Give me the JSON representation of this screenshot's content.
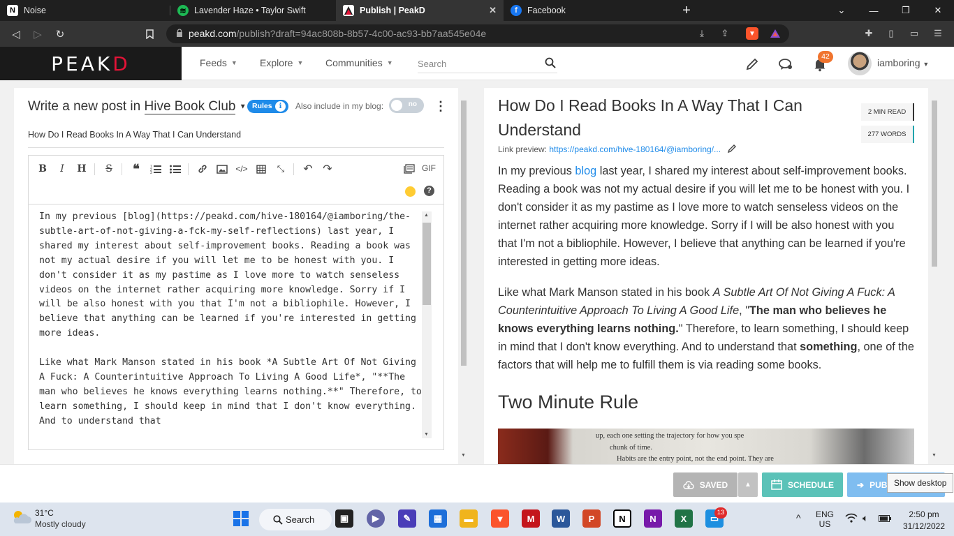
{
  "browser": {
    "tabs": [
      {
        "title": "Noise",
        "icon": "notion-icon"
      },
      {
        "title": "Lavender Haze • Taylor Swift",
        "icon": "spotify-icon"
      },
      {
        "title": "Publish | PeakD",
        "icon": "peakd-icon",
        "active": true
      },
      {
        "title": "Facebook",
        "icon": "facebook-icon"
      }
    ],
    "new_tab": "+",
    "url_host": "peakd.com",
    "url_path": "/publish?draft=94ac808b-8b57-4c00-ac93-bb7aa545e04e"
  },
  "header": {
    "logo_main": "PEAK",
    "logo_accent": "D",
    "nav": [
      "Feeds",
      "Explore",
      "Communities"
    ],
    "search_placeholder": "Search",
    "notifications_count": "42",
    "username": "iamboring"
  },
  "editor": {
    "write_prefix": "Write a new post in",
    "community": "Hive Book Club",
    "rules_label": "Rules",
    "also_include_label": "Also include in my blog:",
    "toggle_label": "no",
    "post_title": "How Do I Read Books In A Way That I Can Understand",
    "toolbar": [
      "bold",
      "italic",
      "heading",
      "strikethrough",
      "quote",
      "ordered-list",
      "unordered-list",
      "link",
      "image",
      "code",
      "table",
      "fullscreen",
      "undo",
      "redo"
    ],
    "gif_label": "GIF",
    "markdown": "In my previous [blog](https://peakd.com/hive-180164/@iamboring/the-subtle-art-of-not-giving-a-fck-my-self-reflections) last year, I shared my interest about self-improvement books. Reading a book was not my actual desire if you will let me to be honest with you. I don't consider it as my pastime as I love more to watch senseless videos on the internet rather acquiring more knowledge. Sorry if I will be also honest with you that I'm not a bibliophile. However, I believe that anything can be learned if you're interested in getting more ideas.\n\nLike what Mark Manson stated in his book *A Subtle Art Of Not Giving A Fuck: A Counterintuitive Approach To Living A Good Life*, \"**The man who believes he knows everything learns nothing.**\" Therefore, to learn something, I should keep in mind that I don't know everything. And to understand that"
  },
  "preview": {
    "title": "How Do I Read Books In A Way That I Can Understand",
    "read_time": "2 MIN READ",
    "word_count": "277 WORDS",
    "link_preview_label": "Link preview:",
    "link_preview_url": "https://peakd.com/hive-180164/@iamboring/...",
    "p1_before": "In my previous ",
    "p1_link": "blog",
    "p1_after": " last year, I shared my interest about self-improvement books. Reading a book was not my actual desire if you will let me to be honest with you. I don't consider it as my pastime as I love more to watch senseless videos on the internet rather acquiring more knowledge. Sorry if I will be also honest with you that I'm not a bibliophile. However, I believe that anything can be learned if you're interested in getting more ideas.",
    "p2_a": "Like what Mark Manson stated in his book ",
    "p2_italic": "A Subtle Art Of Not Giving A Fuck: A Counterintuitive Approach To Living A Good Life",
    "p2_b": ", \"",
    "p2_bold": "The man who believes he knows everything learns nothing.",
    "p2_c": "\" Therefore, to learn something, I should keep in mind that I don't know everything. And to understand that ",
    "p2_bold2": "something",
    "p2_d": ", one of the factors that will help me to fulfill them is via reading some books.",
    "heading": "Two Minute Rule",
    "image_line1": "up, each one setting the trajectory for how you spe",
    "image_line2": "chunk of time.",
    "image_line3": "Habits are the entry point, not the end point. They are"
  },
  "actions": {
    "saved": "SAVED",
    "schedule": "SCHEDULE",
    "publish": "PUBLISH",
    "tooltip": "Show desktop"
  },
  "taskbar": {
    "temperature": "31°C",
    "condition": "Mostly cloudy",
    "search": "Search",
    "teams_badge": "13",
    "lang1": "ENG",
    "lang2": "US",
    "time": "2:50 pm",
    "date": "31/12/2022"
  },
  "colors": {
    "brand_red": "#e31337",
    "link_blue": "#1f8be9",
    "schedule_teal": "#5bc2b8",
    "publish_blue": "#7fbdf0",
    "saved_gray": "#b4b4b4"
  }
}
